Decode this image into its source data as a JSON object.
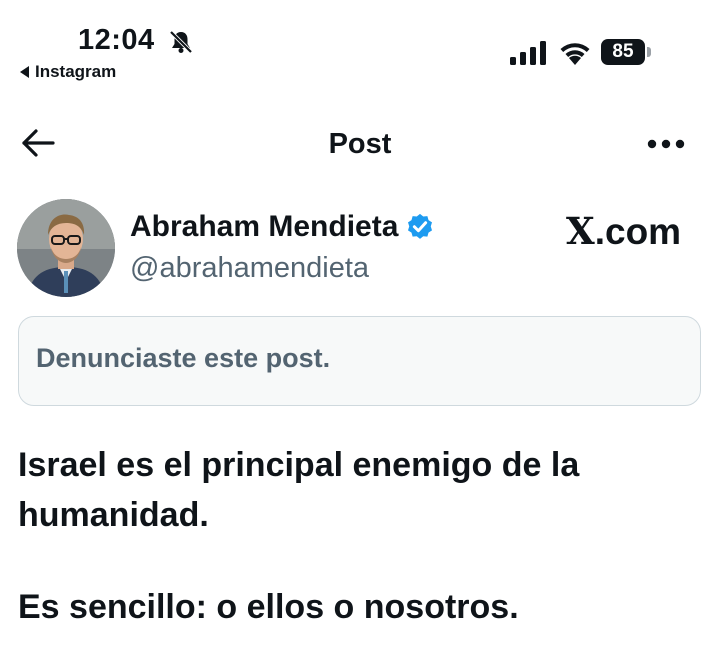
{
  "status_bar": {
    "time": "12:04",
    "back_app": "Instagram",
    "battery": "85",
    "icons": [
      "bell-slash-icon",
      "cellular-signal-icon",
      "wifi-icon",
      "battery-icon"
    ]
  },
  "nav": {
    "title": "Post",
    "icons": [
      "back-arrow-icon",
      "more-icon"
    ]
  },
  "author": {
    "name": "Abraham Mendieta",
    "handle": "@abrahamendieta",
    "verified": true,
    "verified_color": "#1d9bf0"
  },
  "brand": {
    "x": "X",
    "domain": ".com"
  },
  "notice": {
    "text": "Denunciaste este post."
  },
  "post": {
    "line1": "Israel es el principal enemigo de la humanidad.",
    "line2": "Es sencillo: o ellos o nosotros."
  },
  "colors": {
    "text": "#0f1419",
    "secondary": "#536471",
    "notice_bg": "#f7f9f9",
    "notice_border": "#cfd9de"
  }
}
